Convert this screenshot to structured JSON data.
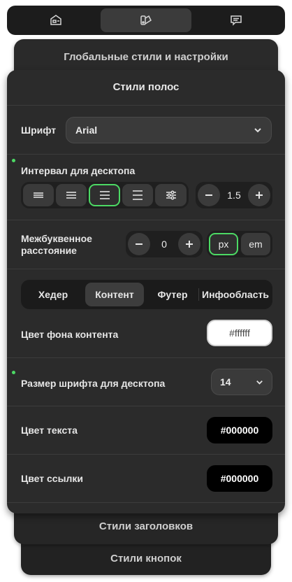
{
  "topbar": {
    "tabs": [
      {
        "icon": "page-icon",
        "active": false
      },
      {
        "icon": "palette-icon",
        "active": true
      },
      {
        "icon": "chat-icon",
        "active": false
      }
    ]
  },
  "panels": {
    "global_title": "Глобальные стили и настройки",
    "main_title": "Стили полос",
    "headings_title": "Стили заголовков",
    "buttons_title": "Стили кнопок"
  },
  "font": {
    "label": "Шрифт",
    "value": "Arial"
  },
  "interval": {
    "label": "Интервал для десктопа",
    "align_options": [
      "justify-icon",
      "align-left-icon",
      "align-center-icon",
      "align-right-icon",
      "settings-sliders-icon"
    ],
    "selected_index": 2,
    "value": "1.5"
  },
  "letter_spacing": {
    "label_line1": "Межбуквенное",
    "label_line2": "расстояние",
    "value": "0",
    "units": [
      "px",
      "em"
    ],
    "selected_unit": "px"
  },
  "section_tabs": {
    "items": [
      "Хедер",
      "Контент",
      "Футер",
      "Инфообласть"
    ],
    "active_index": 1
  },
  "content": {
    "bg_label": "Цвет фона контента",
    "bg_value": "#ffffff",
    "font_size_label": "Размер шрифта для десктопа",
    "font_size_value": "14",
    "text_color_label": "Цвет текста",
    "text_color_value": "#000000",
    "link_color_label": "Цвет ссылки",
    "link_color_value": "#000000"
  },
  "colors": {
    "accent": "#4cd964",
    "panel": "#2b2b2b",
    "background": "#ffffff"
  }
}
